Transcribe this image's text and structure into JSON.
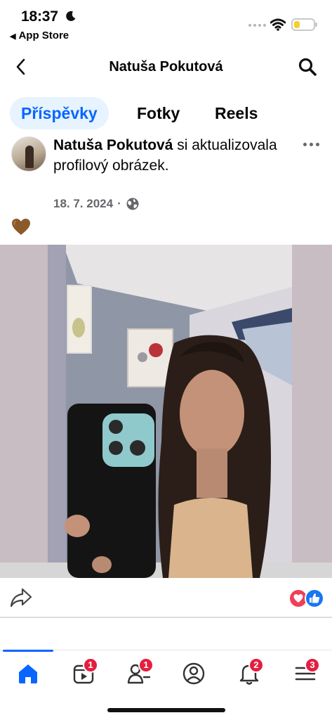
{
  "status_bar": {
    "time": "18:37",
    "back_label": "App Store",
    "battery_level": 0.3,
    "icons": [
      "moon-icon",
      "signal-icon",
      "wifi-icon",
      "battery-icon"
    ]
  },
  "header": {
    "title": "Natuša Pokutová",
    "icons": [
      "chevron-left-icon",
      "search-icon"
    ]
  },
  "tabs": [
    {
      "label": "Příspěvky",
      "active": true
    },
    {
      "label": "Fotky",
      "active": false
    },
    {
      "label": "Reels",
      "active": false
    }
  ],
  "post": {
    "author": "Natuša Pokutová",
    "action_text": " si aktualizovala profilový obrázek.",
    "date": "18. 7. 2024",
    "separator": "·",
    "audience_icon": "globe-icon",
    "reaction_emoji": "brown-heart-icon",
    "more_icon": "more-horizontal-icon"
  },
  "post_actions": {
    "share_icon": "share-icon",
    "reaction_icons": [
      "love-reaction-icon",
      "like-reaction-icon"
    ]
  },
  "bottom_nav": [
    {
      "icon": "home-icon",
      "badge": "",
      "active": true
    },
    {
      "icon": "video-icon",
      "badge": "1",
      "active": false
    },
    {
      "icon": "friends-icon",
      "badge": "1",
      "active": false
    },
    {
      "icon": "profile-icon",
      "badge": "",
      "active": false
    },
    {
      "icon": "bell-icon",
      "badge": "2",
      "active": false
    },
    {
      "icon": "menu-icon",
      "badge": "3",
      "active": false
    }
  ],
  "colors": {
    "accent": "#0866ff",
    "tab_active_bg": "#e7f3ff",
    "badge": "#e41e3f",
    "secondary_text": "#65676b"
  }
}
